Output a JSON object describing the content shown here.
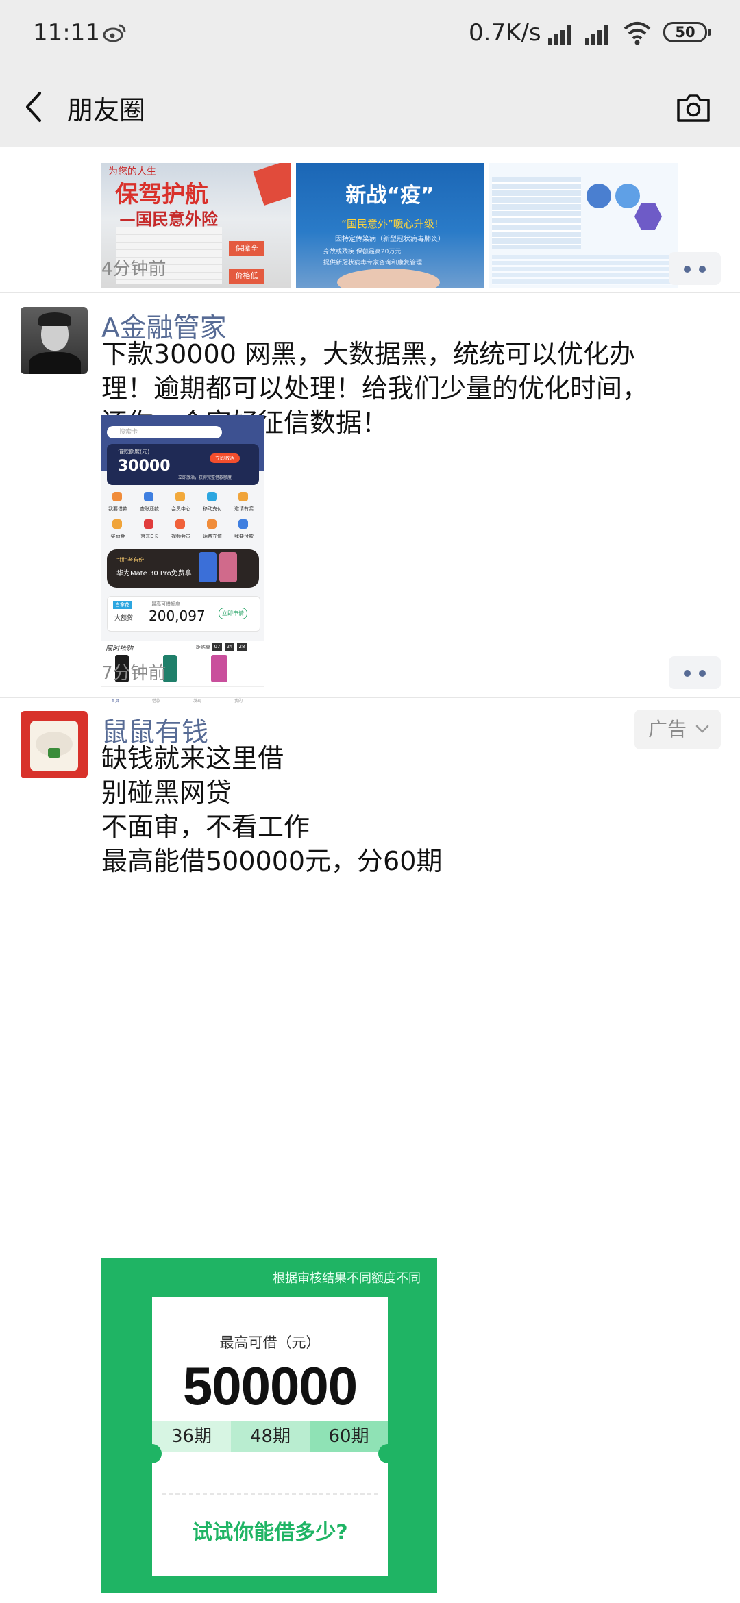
{
  "status_bar": {
    "time": "11:11",
    "network_speed": "0.7K/s",
    "battery": "50"
  },
  "nav": {
    "title": "朋友圈"
  },
  "post1": {
    "time": "4分钟前",
    "images": [
      {
        "caption_top": "为您的人生",
        "caption_main": "保驾护航",
        "caption_sub": "—国民意外险",
        "badge1": "保障全",
        "badge2": "价格低"
      },
      {
        "caption_main": "新战“疫”",
        "caption_line1": "“国民意外”暖心升级!",
        "caption_line2": "因特定传染病（新型冠状病毒肺炎）",
        "check1": "身故或残疾 保额最高20万元",
        "check2": "提供新冠状病毒专家咨询和康复管理"
      },
      {}
    ]
  },
  "post2": {
    "author": "A金融管家",
    "text": "下款30000 网黑，大数据黑，统统可以优化办\n理！逾期都可以处理！给我们少量的优化时间，\n还你一个完好征信数据！",
    "time": "7分钟前",
    "screenshot": {
      "search_placeholder": "搜索卡",
      "limit_label": "借款额度(元)",
      "amount": "30000",
      "apply": "立即激活",
      "hint": "立即激活，获得完整借款额度",
      "grid_row1": [
        "我要借款",
        "查账还款",
        "会员中心",
        "移动支付",
        "邀请有奖"
      ],
      "grid_row2": [
        "奖励金",
        "京东E卡",
        "视频会员",
        "话费充值",
        "我要付款"
      ],
      "banner_small": "“拼”者有份",
      "banner_main": "华为Mate 30 Pro免费拿",
      "credit_tag": "白拿花",
      "credit_label": "大额贷",
      "credit_top": "最高可借额度",
      "credit_amount": "200,097",
      "credit_btn": "立即申请",
      "flash_title": "限时抢购",
      "flash_end": "距结束",
      "clock": [
        "07",
        "24",
        "28"
      ],
      "tabs": [
        "首页",
        "借款",
        "发现",
        "我的"
      ]
    }
  },
  "post3": {
    "author": "鼠鼠有钱",
    "ad_tag": "广告",
    "text": "缺钱就来这里借\n别碰黑网贷\n不面审，不看工作\n最高能借500000元，分60期",
    "ad_image": {
      "note": "根据审核结果不同额度不同",
      "max_label": "最高可借（元）",
      "amount": "500000",
      "terms": [
        "36期",
        "48期",
        "60期"
      ],
      "cta": "试试你能借多少?"
    }
  },
  "colors": {
    "link_blue": "#576b95",
    "ad_green": "#1fb464",
    "background_gray": "#ededed"
  }
}
